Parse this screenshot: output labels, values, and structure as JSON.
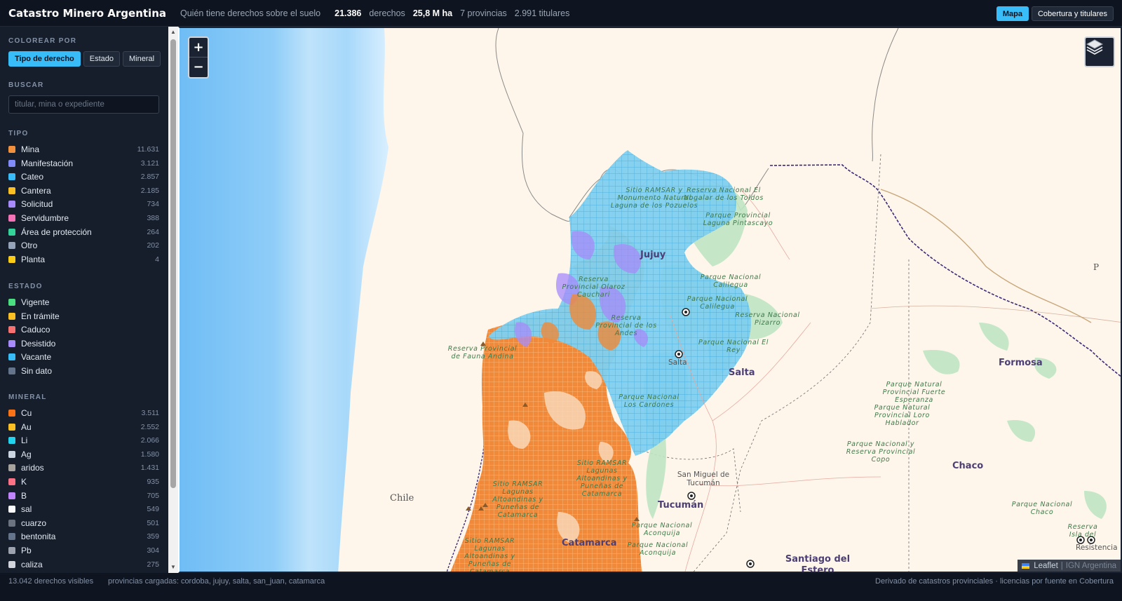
{
  "header": {
    "title": "Catastro Minero Argentina",
    "tagline": "Quién tiene derechos sobre el suelo",
    "stats": [
      {
        "value": "21.386",
        "label": "derechos"
      },
      {
        "value": "25,8 M ha",
        "label": ""
      },
      {
        "value": "",
        "label": "7 provincias"
      },
      {
        "value": "",
        "label": "2.991 titulares"
      }
    ],
    "buttons": {
      "map": "Mapa",
      "coverage": "Cobertura y titulares"
    }
  },
  "sidebar": {
    "color_by": {
      "title": "COLOREAR POR",
      "options": [
        "Tipo de derecho",
        "Estado",
        "Mineral"
      ],
      "active": "Tipo de derecho"
    },
    "search": {
      "title": "BUSCAR",
      "placeholder": "titular, mina o expediente",
      "value": ""
    },
    "tipo": {
      "title": "TIPO",
      "items": [
        {
          "label": "Mina",
          "count": "11.631",
          "color": "#f2913d"
        },
        {
          "label": "Manifestación",
          "count": "3.121",
          "color": "#818cf8"
        },
        {
          "label": "Cateo",
          "count": "2.857",
          "color": "#38bdf8"
        },
        {
          "label": "Cantera",
          "count": "2.185",
          "color": "#fbbf24"
        },
        {
          "label": "Solicitud",
          "count": "734",
          "color": "#a78bfa"
        },
        {
          "label": "Servidumbre",
          "count": "388",
          "color": "#f472b6"
        },
        {
          "label": "Área de protección",
          "count": "264",
          "color": "#34d399"
        },
        {
          "label": "Otro",
          "count": "202",
          "color": "#94a3b8"
        },
        {
          "label": "Planta",
          "count": "4",
          "color": "#facc15"
        }
      ]
    },
    "estado": {
      "title": "ESTADO",
      "items": [
        {
          "label": "Vigente",
          "color": "#4ade80"
        },
        {
          "label": "En trámite",
          "color": "#fbbf24"
        },
        {
          "label": "Caduco",
          "color": "#f87171"
        },
        {
          "label": "Desistido",
          "color": "#a78bfa"
        },
        {
          "label": "Vacante",
          "color": "#38bdf8"
        },
        {
          "label": "Sin dato",
          "color": "#64748b"
        }
      ]
    },
    "mineral": {
      "title": "MINERAL",
      "items": [
        {
          "label": "Cu",
          "count": "3.511",
          "color": "#f97316"
        },
        {
          "label": "Au",
          "count": "2.552",
          "color": "#fbbf24"
        },
        {
          "label": "Li",
          "count": "2.066",
          "color": "#22d3ee"
        },
        {
          "label": "Ag",
          "count": "1.580",
          "color": "#cbd5e1"
        },
        {
          "label": "aridos",
          "count": "1.431",
          "color": "#a8a29e"
        },
        {
          "label": "K",
          "count": "935",
          "color": "#fb7185"
        },
        {
          "label": "B",
          "count": "705",
          "color": "#c084fc"
        },
        {
          "label": "sal",
          "count": "549",
          "color": "#f8fafc"
        },
        {
          "label": "cuarzo",
          "count": "501",
          "color": "#6b7280"
        },
        {
          "label": "bentonita",
          "count": "359",
          "color": "#64748b"
        },
        {
          "label": "Pb",
          "count": "304",
          "color": "#9ca3af"
        },
        {
          "label": "caliza",
          "count": "275",
          "color": "#d1d5db"
        }
      ]
    }
  },
  "map": {
    "zoom_in": "+",
    "zoom_out": "−",
    "attribution": {
      "leaflet": "Leaflet",
      "sep": "|",
      "source": "IGN Argentina"
    },
    "labels": {
      "provinces": [
        "Jujuy",
        "Salta",
        "Tucumán",
        "Catamarca",
        "Santiago del Estero",
        "Formosa",
        "Chaco"
      ],
      "countries": [
        "Chile"
      ],
      "cities": [
        "Salta",
        "San Miguel de Tucumán"
      ],
      "partial": [
        "P"
      ],
      "parks": [
        "Sitio RAMSAR y Monumento Natural Laguna de los Pozuelos",
        "Reserva Nacional El Nogalar de los Toldos",
        "Parque Provincial Laguna Pintascayo",
        "Parque Nacional Calilegua",
        "Parque Nacional Calilegua",
        "Reserva Provincial Olaroz Cauchari",
        "Reserva Nacional Pizarro",
        "Reserva Provincial de Fauna Andina",
        "Reserva Provincial de los Andes",
        "Parque Nacional El Rey",
        "Parque Nacional Los Cardones",
        "Parque Natural Provincial Fuerte Esperanza",
        "Parque Natural Provincial Loro Hablador",
        "Parque Nacional y Reserva Provincial Copo",
        "Sitio RAMSAR Lagunas Altoandinas y Puneñas de Catamarca",
        "Sitio RAMSAR Lagunas Altoandinas y Puneñas de Catamarca",
        "Sitio RAMSAR Lagunas Altoandinas y Puneñas de Catamarca",
        "Parque Nacional Aconquija",
        "Parque Nacional Aconquija",
        "Parque Nacional Chaco",
        "Reserva Isla del",
        "Resistencia"
      ]
    }
  },
  "footer": {
    "visible": "13.042 derechos visibles",
    "loaded": "provincias cargadas: cordoba, jujuy, salta, san_juan, catamarca",
    "source": "Derivado de catastros provinciales · licencias por fuente en Cobertura"
  }
}
